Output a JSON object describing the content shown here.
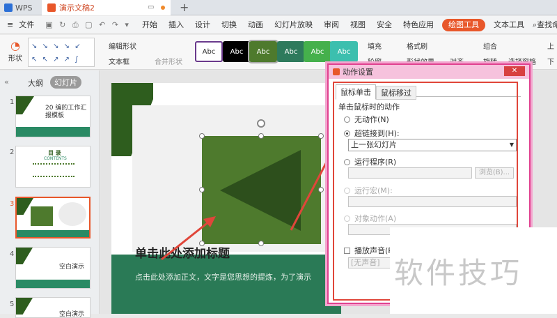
{
  "titlebar": {
    "app": "WPS",
    "doc_tab": "演示文稿2",
    "new_tab": "+"
  },
  "menu": {
    "file": "文件",
    "items": [
      "开始",
      "插入",
      "设计",
      "切换",
      "动画",
      "幻灯片放映",
      "审阅",
      "视图",
      "安全",
      "特色应用"
    ],
    "active": "绘图工具",
    "text_tool": "文本工具",
    "search": "查找命令"
  },
  "ribbon": {
    "shape": "形状",
    "edit_shape": "编辑形状",
    "textbox": "文本框",
    "merge": "合并形状",
    "style_label": "Abc",
    "fill": "填充",
    "outline": "轮廓",
    "format_brush": "格式刷",
    "shape_effect": "形状效果",
    "align": "对齐",
    "group": "组合",
    "rotate": "旋转",
    "select_pane": "选择窗格",
    "up": "上",
    "down": "下"
  },
  "panel": {
    "tab_outline": "大纲",
    "tab_slides": "幻灯片",
    "slide_numbers": [
      "1",
      "2",
      "3",
      "4",
      "5"
    ],
    "s1_title": "20  编的工作汇报模板",
    "s2_title": "目 录",
    "s2_sub": "CONTENTS",
    "s4_title": "空白演示",
    "s5_title": "空白演示"
  },
  "slide": {
    "title": "单击此处添加标题",
    "body": "点击此处添加正文，文字是您思想的提炼，为了演示"
  },
  "dialog": {
    "title": "动作设置",
    "tab_click": "鼠标单击",
    "tab_hover": "鼠标移过",
    "section": "单击鼠标时的动作",
    "opt_none": "无动作(N)",
    "opt_link": "超链接到(H):",
    "link_value": "上一张幻灯片",
    "opt_run": "运行程序(R)",
    "browse": "浏览(B)...",
    "opt_macro": "运行宏(M):",
    "opt_object": "对象动作(A)",
    "play_sound": "播放声音(P):",
    "sound_value": "[无声音]"
  },
  "watermark": "软件技巧",
  "colors": {
    "accent": "#e8572a",
    "green_dark": "#2e5d1e",
    "green": "#4e7a2d",
    "teal": "#2a8a64",
    "pink": "#e0418f"
  }
}
